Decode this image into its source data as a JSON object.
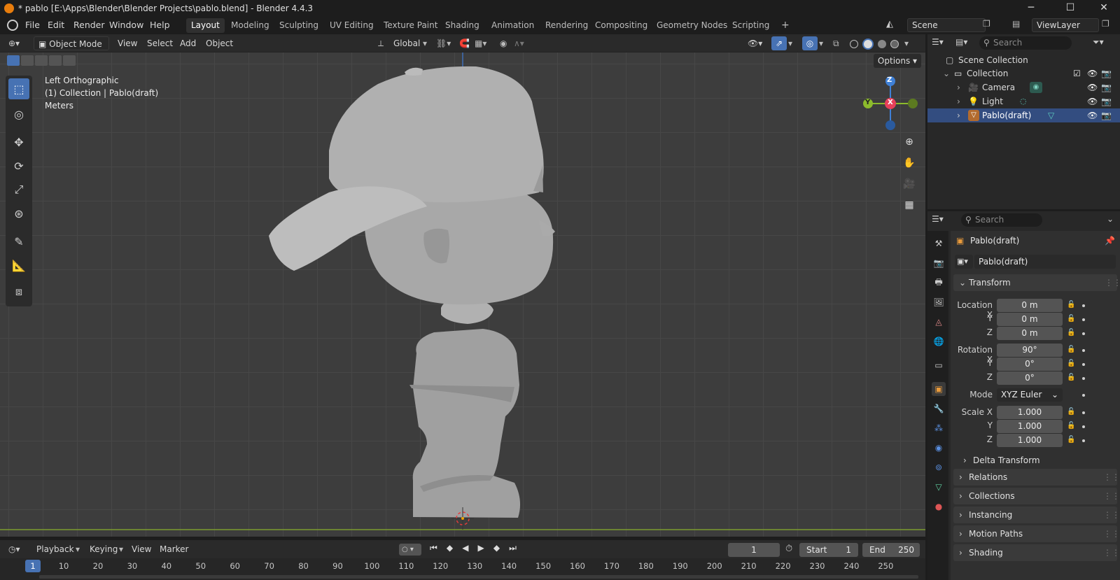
{
  "window": {
    "title": "* pablo [E:\\Apps\\Blender\\Blender Projects\\pablo.blend] - Blender 4.4.3",
    "minimize": "─",
    "maximize": "☐",
    "close": "✕"
  },
  "menu": [
    "File",
    "Edit",
    "Render",
    "Window",
    "Help"
  ],
  "workspaces": [
    "Layout",
    "Modeling",
    "Sculpting",
    "UV Editing",
    "Texture Paint",
    "Shading",
    "Animation",
    "Rendering",
    "Compositing",
    "Geometry Nodes",
    "Scripting"
  ],
  "workspace_add": "+",
  "scene": {
    "name": "Scene",
    "view_layer": "ViewLayer"
  },
  "viewport_header": {
    "mode": "Object Mode",
    "menus": [
      "View",
      "Select",
      "Add",
      "Object"
    ],
    "orientation": "Global",
    "options": "Options"
  },
  "viewport": {
    "view_name": "Left Orthographic",
    "collection_info": "(1) Collection | Pablo(draft)",
    "units": "Meters",
    "gizmo": {
      "z": "Z",
      "x": "X",
      "y": "Y"
    }
  },
  "outliner": {
    "search_placeholder": "Search",
    "scene_collection": "Scene Collection",
    "collection": "Collection",
    "items": [
      "Camera",
      "Light",
      "Pablo(draft)"
    ]
  },
  "properties": {
    "search_placeholder": "Search",
    "object_name": "Pablo(draft)",
    "data_name": "Pablo(draft)",
    "transform_title": "Transform",
    "location_label": "Location X",
    "location": [
      "0 m",
      "0 m",
      "0 m"
    ],
    "rotation_label": "Rotation X",
    "rotation": [
      "90°",
      "0°",
      "0°"
    ],
    "mode_label": "Mode",
    "rotation_mode": "XYZ Euler",
    "scale_label": "Scale X",
    "scale": [
      "1.000",
      "1.000",
      "1.000"
    ],
    "axis_y": "Y",
    "axis_z": "Z",
    "delta_transform": "Delta Transform",
    "panels": [
      "Relations",
      "Collections",
      "Instancing",
      "Motion Paths",
      "Shading"
    ]
  },
  "timeline": {
    "menus": [
      "Playback",
      "Keying",
      "View",
      "Marker"
    ],
    "current_frame": "1",
    "start_label": "Start",
    "start": "1",
    "end_label": "End",
    "end": "250",
    "ticks": [
      "1",
      "10",
      "20",
      "30",
      "40",
      "50",
      "60",
      "70",
      "80",
      "90",
      "100",
      "110",
      "120",
      "130",
      "140",
      "150",
      "160",
      "170",
      "180",
      "190",
      "200",
      "210",
      "220",
      "230",
      "240",
      "250"
    ]
  },
  "colors": {
    "accent": "#4772b3",
    "selected_row": "#334d80",
    "x_axis": "#e8405a",
    "y_axis": "#8cbb2c",
    "z_axis": "#3f80d6"
  }
}
